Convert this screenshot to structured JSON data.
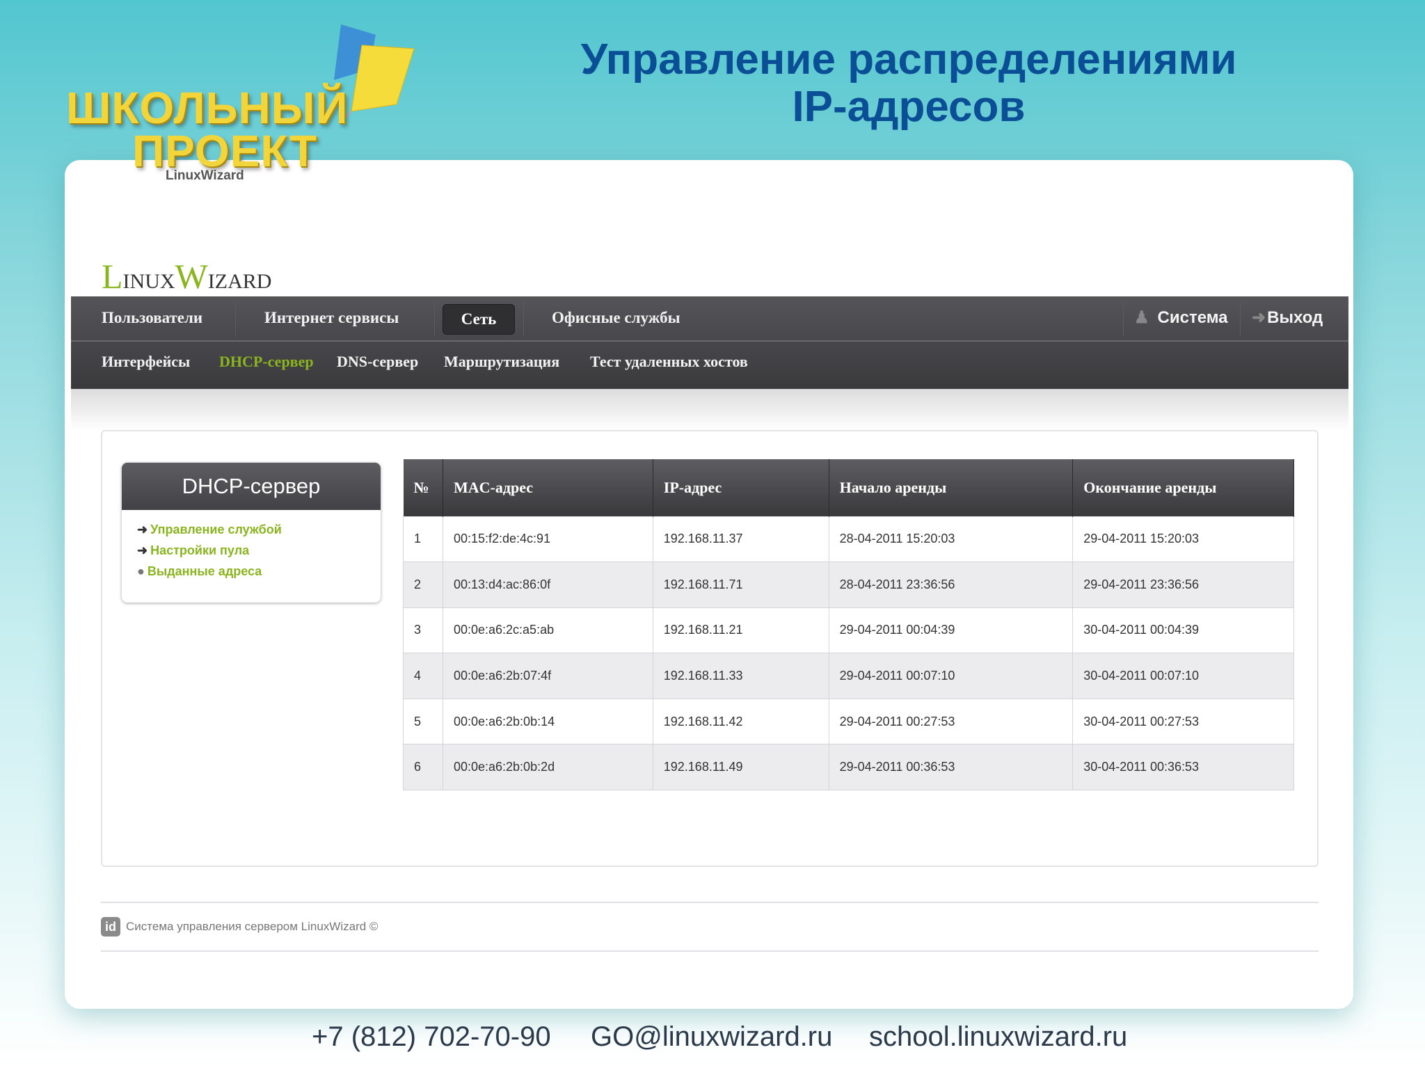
{
  "slide_title": [
    "Управление распределениями",
    "IP-адресов"
  ],
  "school_logo": {
    "line1": "ШКОЛЬНЫЙ",
    "line2": "ПРОЕКТ",
    "sub": "LinuxWizard"
  },
  "app_logo": {
    "l": "L",
    "inux": "INUX",
    "w": "W",
    "izard": "IZARD"
  },
  "nav": {
    "main": [
      "Пользователи",
      "Интернет сервисы",
      "Сеть",
      "Офисные службы"
    ],
    "active_main": "Сеть",
    "system": "Система",
    "logout": "Выход",
    "sub": [
      "Интерфейсы",
      "DHCP-сервер",
      "DNS-сервер",
      "Маршрутизация",
      "Тест удаленных хостов"
    ],
    "active_sub": "DHCP-сервер",
    "accent": "#8ab51f"
  },
  "sidebar": {
    "title": "DHCP-сервер",
    "links": [
      "Управление службой",
      "Настройки пула",
      "Выданные адреса"
    ],
    "active": "Выданные адреса"
  },
  "table": {
    "headers": [
      "№",
      "MAC-адрес",
      "IP-адрес",
      "Начало аренды",
      "Окончание аренды"
    ],
    "rows": [
      [
        "1",
        "00:15:f2:de:4c:91",
        "192.168.11.37",
        "28-04-2011 15:20:03",
        "29-04-2011 15:20:03"
      ],
      [
        "2",
        "00:13:d4:ac:86:0f",
        "192.168.11.71",
        "28-04-2011 23:36:56",
        "29-04-2011 23:36:56"
      ],
      [
        "3",
        "00:0e:a6:2c:a5:ab",
        "192.168.11.21",
        "29-04-2011 00:04:39",
        "30-04-2011 00:04:39"
      ],
      [
        "4",
        "00:0e:a6:2b:07:4f",
        "192.168.11.33",
        "29-04-2011 00:07:10",
        "30-04-2011 00:07:10"
      ],
      [
        "5",
        "00:0e:a6:2b:0b:14",
        "192.168.11.42",
        "29-04-2011 00:27:53",
        "30-04-2011 00:27:53"
      ],
      [
        "6",
        "00:0e:a6:2b:0b:2d",
        "192.168.11.49",
        "29-04-2011 00:36:53",
        "30-04-2011 00:36:53"
      ]
    ]
  },
  "footer": {
    "icon": "id",
    "text": "Система управления сервером LinuxWizard ©"
  },
  "contacts": {
    "phone": "+7 (812) 702-70-90",
    "email": "GO@linuxwizard.ru",
    "site": "school.linuxwizard.ru"
  }
}
